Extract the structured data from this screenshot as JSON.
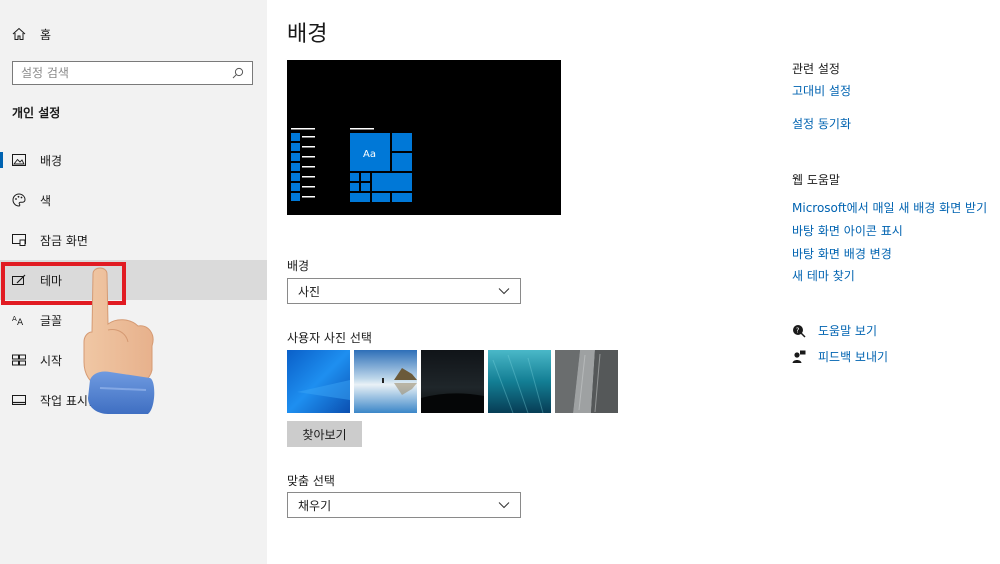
{
  "sidebar": {
    "home_label": "홈",
    "search_placeholder": "설정 검색",
    "section_title": "개인 설정",
    "items": [
      {
        "label": "배경",
        "icon": "picture-icon",
        "selected": true
      },
      {
        "label": "색",
        "icon": "palette-icon"
      },
      {
        "label": "잠금 화면",
        "icon": "lock-screen-icon"
      },
      {
        "label": "테마",
        "icon": "theme-icon",
        "hover": true
      },
      {
        "label": "글꼴",
        "icon": "font-icon"
      },
      {
        "label": "시작",
        "icon": "start-icon"
      },
      {
        "label": "작업 표시줄",
        "icon": "taskbar-icon"
      }
    ]
  },
  "main": {
    "title": "배경",
    "preview_sample_text": "Aa",
    "background_label": "배경",
    "background_value": "사진",
    "choose_picture_label": "사용자 사진 선택",
    "browse_label": "찾아보기",
    "fit_label": "맞춤 선택",
    "fit_value": "채우기"
  },
  "right": {
    "related_title": "관련 설정",
    "related_links": [
      "고대비 설정",
      "설정 동기화"
    ],
    "help_title": "웹 도움말",
    "help_links": [
      "Microsoft에서 매일 새 배경 화면 받기",
      "바탕 화면 아이콘 표시",
      "바탕 화면 배경 변경",
      "새 테마 찾기"
    ],
    "get_help_label": "도움말 보기",
    "feedback_label": "피드백 보내기"
  },
  "colors": {
    "accent": "#0063b1",
    "sidebar_bg": "#f2f2f2",
    "highlight_red": "#e11b22",
    "tile_blue": "#0078d7"
  }
}
